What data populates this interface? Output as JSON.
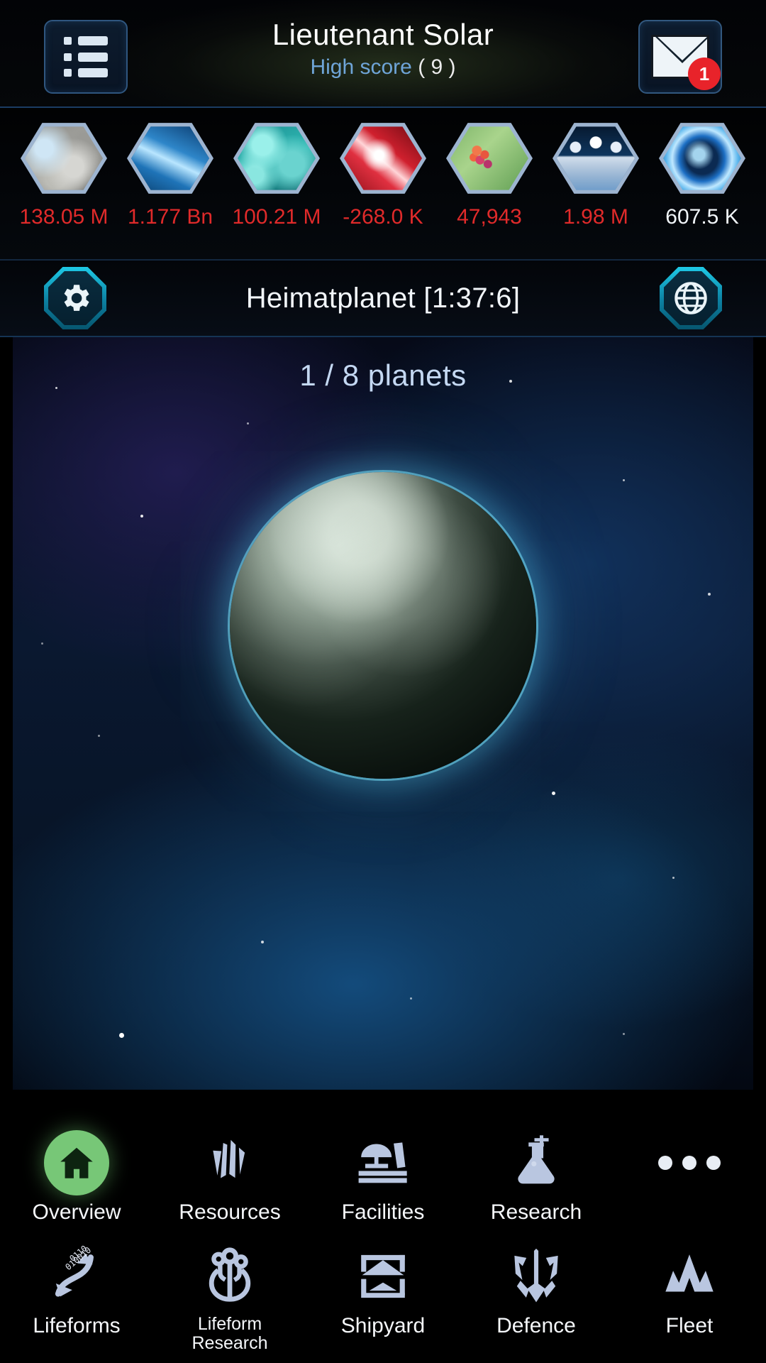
{
  "header": {
    "menu_icon": "list-menu-icon",
    "player_name": "Lieutenant Solar",
    "score_label": "High score",
    "score_value": "( 9 )",
    "mail_icon": "envelope-icon",
    "mail_badge": "1"
  },
  "resources": [
    {
      "id": "metal",
      "icon": "metal-ore-icon",
      "value": "138.05 M",
      "negative": true
    },
    {
      "id": "crystal",
      "icon": "crystal-icon",
      "value": "1.177 Bn",
      "negative": true
    },
    {
      "id": "deuterium",
      "icon": "deuterium-icon",
      "value": "100.21 M",
      "negative": true
    },
    {
      "id": "energy",
      "icon": "energy-icon",
      "value": "-268.0 K",
      "negative": true
    },
    {
      "id": "food",
      "icon": "food-icon",
      "value": "47,943",
      "negative": true
    },
    {
      "id": "population",
      "icon": "population-icon",
      "value": "1.98 M",
      "negative": true
    },
    {
      "id": "darkmatter",
      "icon": "dark-matter-icon",
      "value": "607.5 K",
      "negative": false
    }
  ],
  "planet_bar": {
    "settings_icon": "gear-icon",
    "planet_name": "Heimatplanet [1:37:6]",
    "galaxy_icon": "globe-icon"
  },
  "planet_view": {
    "planets_counter": "1 / 8 planets",
    "planet_image": "planet-sphere"
  },
  "nav": {
    "row1": [
      {
        "id": "overview",
        "icon": "home-icon",
        "label": "Overview",
        "active": true
      },
      {
        "id": "resources",
        "icon": "crystal-icon",
        "label": "Resources",
        "active": false
      },
      {
        "id": "facilities",
        "icon": "factory-icon",
        "label": "Facilities",
        "active": false
      },
      {
        "id": "research",
        "icon": "flask-icon",
        "label": "Research",
        "active": false
      },
      {
        "id": "more",
        "icon": "more-dots-icon",
        "label": "",
        "active": false
      }
    ],
    "row2": [
      {
        "id": "lifeforms",
        "icon": "dna-binary-icon",
        "label": "Lifeforms"
      },
      {
        "id": "lifeform-research",
        "icon": "circuit-tree-icon",
        "label": "Lifeform\nResearch"
      },
      {
        "id": "shipyard",
        "icon": "shipyard-icon",
        "label": "Shipyard"
      },
      {
        "id": "defence",
        "icon": "shield-spear-icon",
        "label": "Defence"
      },
      {
        "id": "fleet",
        "icon": "fleet-arrows-icon",
        "label": "Fleet"
      }
    ]
  },
  "colors": {
    "resource_negative": "#e02a2a",
    "resource_normal": "#f0f4f8",
    "accent_cyan": "#1ec9e6",
    "active_nav": "#77c777",
    "link_blue": "#6fa5d8",
    "badge_red": "#e8232a"
  }
}
